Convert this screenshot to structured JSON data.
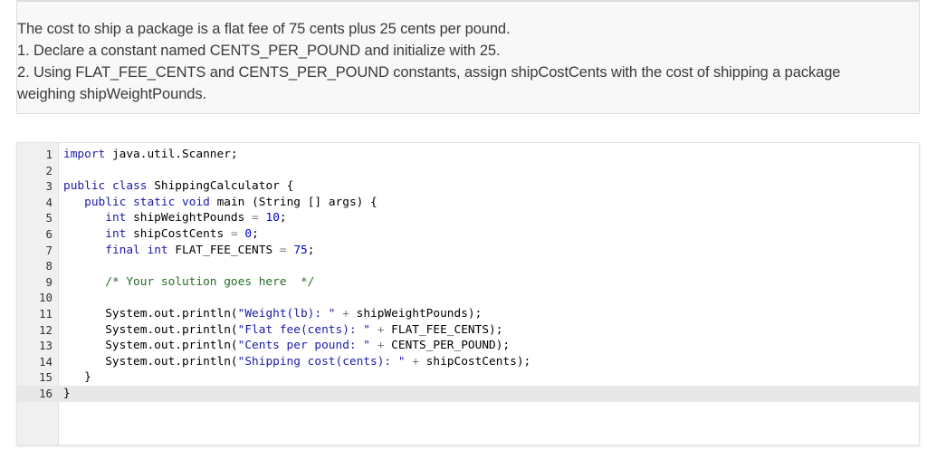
{
  "prompt": {
    "lines": [
      "The cost to ship a package is a flat fee of 75 cents plus 25 cents per pound.",
      "1. Declare a constant named CENTS_PER_POUND and initialize with 25.",
      "2. Using FLAT_FEE_CENTS and CENTS_PER_POUND constants, assign shipCostCents with the cost of shipping a package",
      "weighing shipWeightPounds."
    ]
  },
  "editor": {
    "line_numbers": [
      "1",
      "2",
      "3",
      "4",
      "5",
      "6",
      "7",
      "8",
      "9",
      "10",
      "11",
      "12",
      "13",
      "14",
      "15",
      "16"
    ],
    "lines": [
      "import java.util.Scanner;",
      "",
      "public class ShippingCalculator {",
      "   public static void main (String [] args) {",
      "      int shipWeightPounds = 10;",
      "      int shipCostCents = 0;",
      "      final int FLAT_FEE_CENTS = 75;",
      "",
      "      /* Your solution goes here  */",
      "",
      "      System.out.println(\"Weight(lb): \" + shipWeightPounds);",
      "      System.out.println(\"Flat fee(cents): \" + FLAT_FEE_CENTS);",
      "      System.out.println(\"Cents per pound: \" + CENTS_PER_POUND);",
      "      System.out.println(\"Shipping cost(cents): \" + shipCostCents);",
      "   }",
      "}"
    ]
  }
}
